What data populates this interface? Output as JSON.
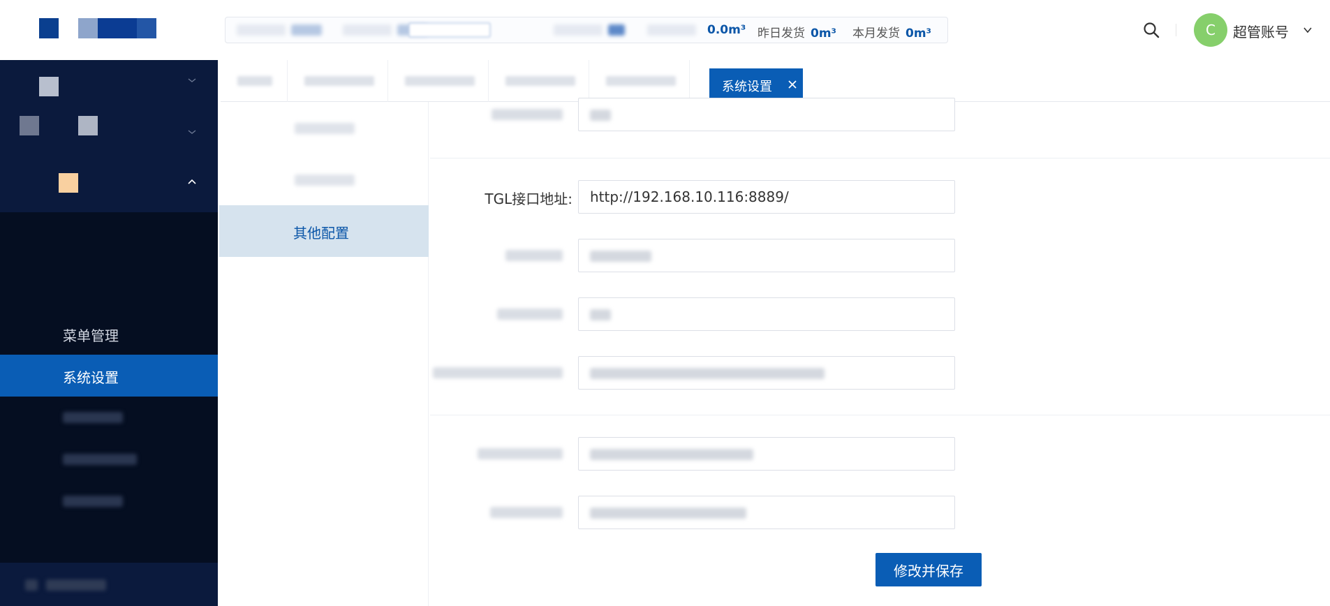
{
  "header": {
    "stats": [
      {
        "label": "",
        "value": "0.0m³"
      },
      {
        "label": "昨日发货",
        "value": "0m³"
      },
      {
        "label": "本月发货",
        "value": "0m³"
      }
    ],
    "user": {
      "avatar_letter": "C",
      "name": "超管账号"
    }
  },
  "sidebar": {
    "items": [
      {
        "label": "菜单管理",
        "active": false
      },
      {
        "label": "系统设置",
        "active": true
      }
    ]
  },
  "tabs": {
    "active_label": "系统设置"
  },
  "submenu": {
    "active_label": "其他配置"
  },
  "form": {
    "tgl_label": "TGL接口地址:",
    "tgl_value": "http://192.168.10.116:8889/",
    "save_label": "修改并保存"
  },
  "colors": {
    "primary": "#0a5db5",
    "sidebar_bg": "#0a1733",
    "submenu_active": "#d6e3ee",
    "avatar": "#86cf6b"
  }
}
